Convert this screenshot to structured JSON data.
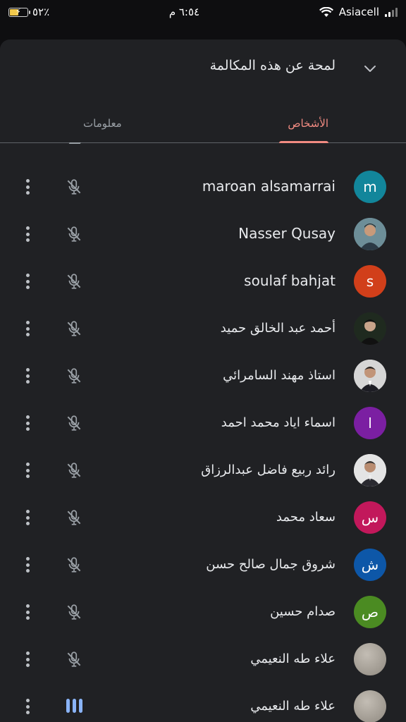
{
  "status_bar": {
    "battery": "٥٢٪",
    "time": "٦:٥٤ م",
    "carrier": "Asiacell"
  },
  "sheet": {
    "title": "لمحة عن هذه المكالمة",
    "collapse_icon": "chevron-down-icon",
    "tabs": [
      {
        "label": "الأشخاص",
        "active": true
      },
      {
        "label": "معلومات",
        "active": false
      }
    ]
  },
  "participants": [
    {
      "name": "maroan alsamarrai",
      "initial": "m",
      "avatar_color": "#12869b",
      "muted": true
    },
    {
      "name": "Nasser Qusay",
      "initial": "",
      "avatar_color": "#5a7d8a",
      "muted": true
    },
    {
      "name": "soulaf bahjat",
      "initial": "s",
      "avatar_color": "#d13f1a",
      "muted": true
    },
    {
      "name": "أحمد عبد الخالق حميد",
      "initial": "",
      "avatar_color": "#2b2b2b",
      "muted": true
    },
    {
      "name": "استاذ مهند السامرائي",
      "initial": "",
      "avatar_color": "#c9c9c9",
      "muted": true
    },
    {
      "name": "اسماء اياد محمد احمد",
      "initial": "ا",
      "avatar_color": "#7b1fa2",
      "muted": true
    },
    {
      "name": "رائد ربيع فاضل عبدالرزاق",
      "initial": "",
      "avatar_color": "#d8d8d8",
      "muted": true
    },
    {
      "name": "سعاد محمد",
      "initial": "س",
      "avatar_color": "#c2185b",
      "muted": true
    },
    {
      "name": "شروق جمال صالح حسن",
      "initial": "ش",
      "avatar_color": "#0d57a8",
      "muted": true
    },
    {
      "name": "صدام حسين",
      "initial": "ص",
      "avatar_color": "#4b8b22",
      "muted": true
    },
    {
      "name": "علاء طه النعيمي",
      "initial": "",
      "avatar_color": "#a8a39b",
      "muted": true
    },
    {
      "name": "علاء طه النعيمي",
      "initial": "",
      "avatar_color": "#a8a39b",
      "muted": false
    }
  ]
}
